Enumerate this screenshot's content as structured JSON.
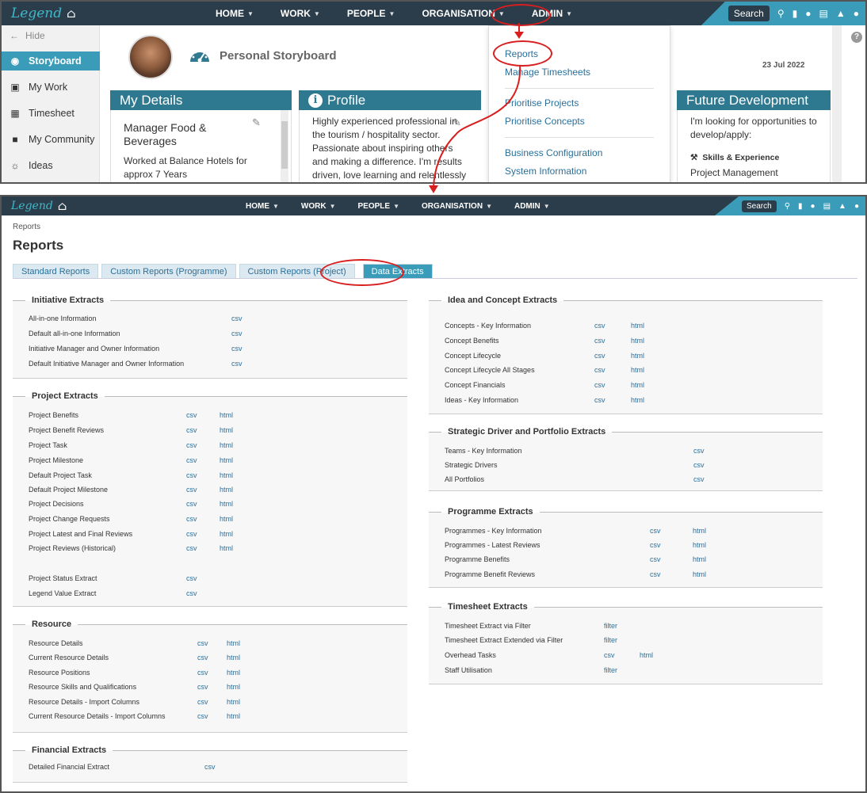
{
  "nav": {
    "logo": "Legend",
    "items": [
      "HOME",
      "WORK",
      "PEOPLE",
      "ORGANISATION",
      "ADMIN"
    ],
    "search": "Search"
  },
  "top": {
    "sidebar": {
      "hide": "Hide",
      "items": [
        {
          "label": "Storyboard",
          "icon": "palette-icon"
        },
        {
          "label": "My Work",
          "icon": "inbox-icon"
        },
        {
          "label": "Timesheet",
          "icon": "calendar-icon"
        },
        {
          "label": "My Community",
          "icon": "chat-icon"
        },
        {
          "label": "Ideas",
          "icon": "lightbulb-icon"
        }
      ]
    },
    "storyboard_title": "Personal Storyboard",
    "date": "23 Jul 2022",
    "my_details": {
      "header": "My Details",
      "job": "Manager Food & Beverages",
      "text": "Worked at Balance Hotels for approx 7 Years"
    },
    "profile": {
      "header": "Profile",
      "text": "Highly experienced professional in the tourism / hospitality sector. Passionate about inspiring others and making a difference. I'm results driven, love learning and relentlessly"
    },
    "future": {
      "header": "Future Development",
      "text": "I'm looking for opportunities to develop/apply:",
      "skills_label": "Skills & Experience",
      "skill": "Project Management"
    },
    "admin_menu": [
      "Reports",
      "Manage Timesheets",
      "Prioritise Projects",
      "Prioritise Concepts",
      "Business Configuration",
      "System Information"
    ]
  },
  "bottom": {
    "breadcrumb": "Reports",
    "title": "Reports",
    "tabs": [
      "Standard Reports",
      "Custom Reports (Programme)",
      "Custom Reports (Project)",
      "Data Extracts"
    ],
    "left_sections": [
      {
        "title": "Initiative Extracts",
        "rows": [
          {
            "name": "All-in-one Information",
            "links": [
              "csv"
            ]
          },
          {
            "name": "Default all-in-one Information",
            "links": [
              "csv"
            ]
          },
          {
            "name": "Initiative Manager and Owner Information",
            "links": [
              "csv"
            ]
          },
          {
            "name": "Default Initiative Manager and Owner Information",
            "links": [
              "csv"
            ]
          }
        ]
      },
      {
        "title": "Project Extracts",
        "rows": [
          {
            "name": "Project Benefits",
            "links": [
              "csv",
              "html"
            ]
          },
          {
            "name": "Project Benefit Reviews",
            "links": [
              "csv",
              "html"
            ]
          },
          {
            "name": "Project Task",
            "links": [
              "csv",
              "html"
            ]
          },
          {
            "name": "Project Milestone",
            "links": [
              "csv",
              "html"
            ]
          },
          {
            "name": "Default Project Task",
            "links": [
              "csv",
              "html"
            ]
          },
          {
            "name": "Default Project Milestone",
            "links": [
              "csv",
              "html"
            ]
          },
          {
            "name": "Project Decisions",
            "links": [
              "csv",
              "html"
            ]
          },
          {
            "name": "Project Change Requests",
            "links": [
              "csv",
              "html"
            ]
          },
          {
            "name": "Project Latest and Final Reviews",
            "links": [
              "csv",
              "html"
            ]
          },
          {
            "name": "Project Reviews (Historical)",
            "links": [
              "csv",
              "html"
            ]
          },
          {
            "name": "Project Status Extract",
            "links": [
              "csv"
            ]
          },
          {
            "name": "Legend Value Extract",
            "links": [
              "csv"
            ]
          }
        ]
      },
      {
        "title": "Resource",
        "rows": [
          {
            "name": "Resource Details",
            "links": [
              "csv",
              "html"
            ]
          },
          {
            "name": "Current Resource Details",
            "links": [
              "csv",
              "html"
            ]
          },
          {
            "name": "Resource Positions",
            "links": [
              "csv",
              "html"
            ]
          },
          {
            "name": "Resource Skills and Qualifications",
            "links": [
              "csv",
              "html"
            ]
          },
          {
            "name": "Resource Details - Import Columns",
            "links": [
              "csv",
              "html"
            ]
          },
          {
            "name": "Current Resource Details - Import Columns",
            "links": [
              "csv",
              "html"
            ]
          }
        ]
      },
      {
        "title": "Financial Extracts",
        "rows": [
          {
            "name": "Detailed Financial Extract",
            "links": [
              "csv"
            ]
          }
        ]
      }
    ],
    "right_sections": [
      {
        "title": "Idea and Concept Extracts",
        "rows": [
          {
            "name": "Concepts - Key Information",
            "links": [
              "csv",
              "html"
            ]
          },
          {
            "name": "Concept Benefits",
            "links": [
              "csv",
              "html"
            ]
          },
          {
            "name": "Concept Lifecycle",
            "links": [
              "csv",
              "html"
            ]
          },
          {
            "name": "Concept Lifecycle All Stages",
            "links": [
              "csv",
              "html"
            ]
          },
          {
            "name": "Concept Financials",
            "links": [
              "csv",
              "html"
            ]
          },
          {
            "name": "Ideas - Key Information",
            "links": [
              "csv",
              "html"
            ]
          }
        ]
      },
      {
        "title": "Strategic Driver and Portfolio Extracts",
        "rows": [
          {
            "name": "Teams - Key Information",
            "links": [
              "csv"
            ]
          },
          {
            "name": "Strategic Drivers",
            "links": [
              "csv"
            ]
          },
          {
            "name": "All Portfolios",
            "links": [
              "csv"
            ]
          }
        ]
      },
      {
        "title": "Programme Extracts",
        "rows": [
          {
            "name": "Programmes - Key Information",
            "links": [
              "csv",
              "html"
            ]
          },
          {
            "name": "Programmes - Latest Reviews",
            "links": [
              "csv",
              "html"
            ]
          },
          {
            "name": "Programme Benefits",
            "links": [
              "csv",
              "html"
            ]
          },
          {
            "name": "Programme Benefit Reviews",
            "links": [
              "csv",
              "html"
            ]
          }
        ]
      },
      {
        "title": "Timesheet Extracts",
        "rows": [
          {
            "name": "Timesheet Extract via Filter",
            "links": [
              "filter"
            ]
          },
          {
            "name": "Timesheet Extract Extended via Filter",
            "links": [
              "filter"
            ]
          },
          {
            "name": "Overhead Tasks",
            "links": [
              "csv",
              "html"
            ]
          },
          {
            "name": "Staff Utilisation",
            "links": [
              "filter"
            ]
          }
        ]
      }
    ]
  },
  "colors": {
    "navbar": "#2b3d4a",
    "accent": "#3a9cb8",
    "card_header": "#2e7890",
    "annotation": "#d81e1e",
    "link": "#2a6f9a"
  }
}
